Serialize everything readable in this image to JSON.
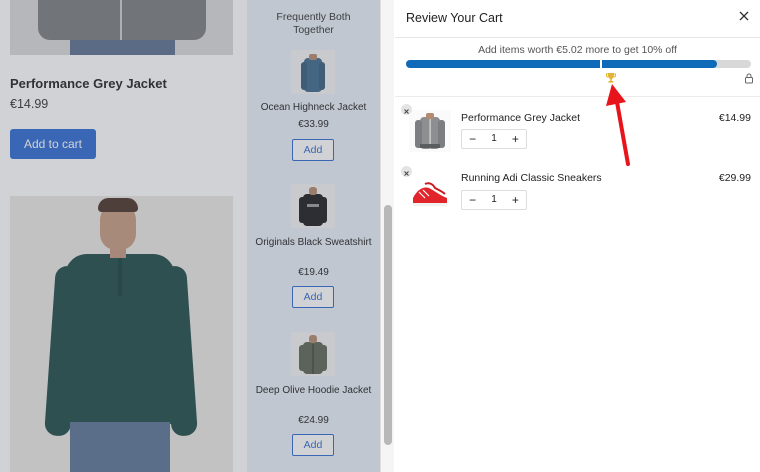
{
  "store": {
    "product_name": "Performance Grey Jacket",
    "product_price": "€14.99",
    "add_to_cart_label": "Add to cart"
  },
  "fbt": {
    "title": "Frequently Both Together",
    "items": [
      {
        "name": "Ocean Highneck Jacket",
        "price": "€33.99",
        "add_label": "Add"
      },
      {
        "name": "Originals Black Sweatshirt",
        "price": "€19.49",
        "add_label": "Add"
      },
      {
        "name": "Deep Olive Hoodie Jacket",
        "price": "€24.99",
        "add_label": "Add"
      }
    ]
  },
  "cart": {
    "title": "Review Your Cart",
    "progress_message": "Add items worth €5.02 more to get 10% off",
    "progress_fraction": 0.9,
    "items": [
      {
        "name": "Performance Grey Jacket",
        "price": "€14.99",
        "qty": "1"
      },
      {
        "name": "Running Adi Classic Sneakers",
        "price": "€29.99",
        "qty": "1"
      }
    ],
    "qty_minus": "−",
    "qty_plus": "+"
  },
  "colors": {
    "accent": "#2f6bd3",
    "progress": "#0f6bb8",
    "annotation": "#e8141c",
    "fbt_background": "#e8f0f8"
  }
}
